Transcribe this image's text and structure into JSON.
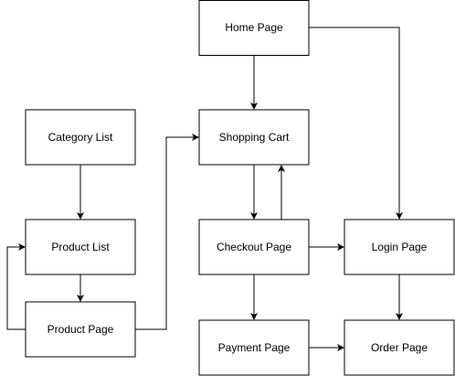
{
  "nodes": {
    "home": {
      "label": "Home Page"
    },
    "category": {
      "label": "Category List"
    },
    "cart": {
      "label": "Shopping Cart"
    },
    "productList": {
      "label": "Product List"
    },
    "checkout": {
      "label": "Checkout Page"
    },
    "login": {
      "label": "Login Page"
    },
    "productPage": {
      "label": "Product Page"
    },
    "payment": {
      "label": "Payment Page"
    },
    "order": {
      "label": "Order Page"
    }
  },
  "edges": [
    {
      "from": "home",
      "to": "cart"
    },
    {
      "from": "home",
      "to": "login"
    },
    {
      "from": "category",
      "to": "productList"
    },
    {
      "from": "productList",
      "to": "productPage"
    },
    {
      "from": "productPage",
      "to": "productList"
    },
    {
      "from": "productPage",
      "to": "cart"
    },
    {
      "from": "cart",
      "to": "checkout"
    },
    {
      "from": "checkout",
      "to": "cart"
    },
    {
      "from": "checkout",
      "to": "login"
    },
    {
      "from": "checkout",
      "to": "payment"
    },
    {
      "from": "login",
      "to": "order"
    },
    {
      "from": "payment",
      "to": "order"
    }
  ],
  "colors": {
    "stroke": "#000000",
    "fill": "#ffffff",
    "text": "#000000"
  }
}
